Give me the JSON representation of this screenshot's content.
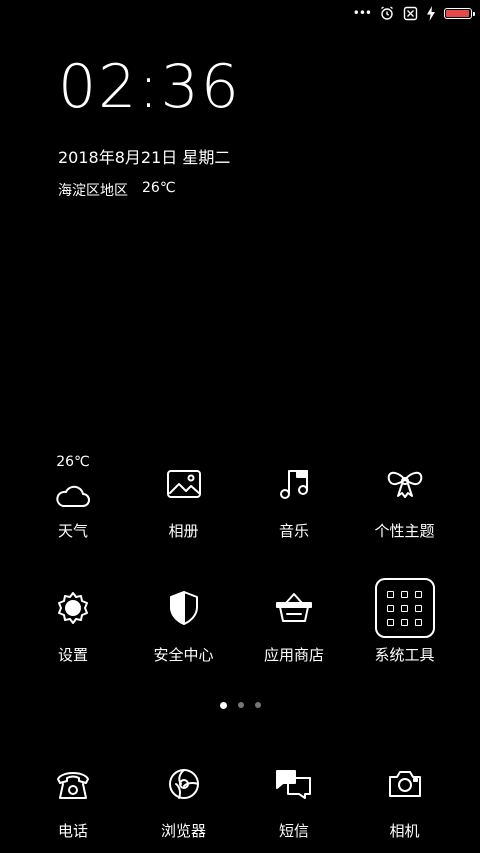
{
  "status_bar": {
    "more": "•••",
    "battery_level": 0.95,
    "battery_color": "#e34b4b"
  },
  "clock": {
    "time": "02:36"
  },
  "date": {
    "text": "2018年8月21日 星期二"
  },
  "weather_widget": {
    "location": "海淀区地区",
    "temperature": "26℃"
  },
  "apps_row1": [
    {
      "label": "天气",
      "icon": "weather-icon",
      "temp": "26℃"
    },
    {
      "label": "相册",
      "icon": "gallery-icon"
    },
    {
      "label": "音乐",
      "icon": "music-icon"
    },
    {
      "label": "个性主题",
      "icon": "themes-icon"
    }
  ],
  "apps_row2": [
    {
      "label": "设置",
      "icon": "settings-icon"
    },
    {
      "label": "安全中心",
      "icon": "security-icon"
    },
    {
      "label": "应用商店",
      "icon": "app-store-icon"
    },
    {
      "label": "系统工具",
      "icon": "system-tools-icon"
    }
  ],
  "dock": [
    {
      "label": "电话",
      "icon": "phone-icon"
    },
    {
      "label": "浏览器",
      "icon": "browser-icon"
    },
    {
      "label": "短信",
      "icon": "messages-icon"
    },
    {
      "label": "相机",
      "icon": "camera-icon"
    }
  ],
  "pager": {
    "pages": 3,
    "current": 1
  }
}
